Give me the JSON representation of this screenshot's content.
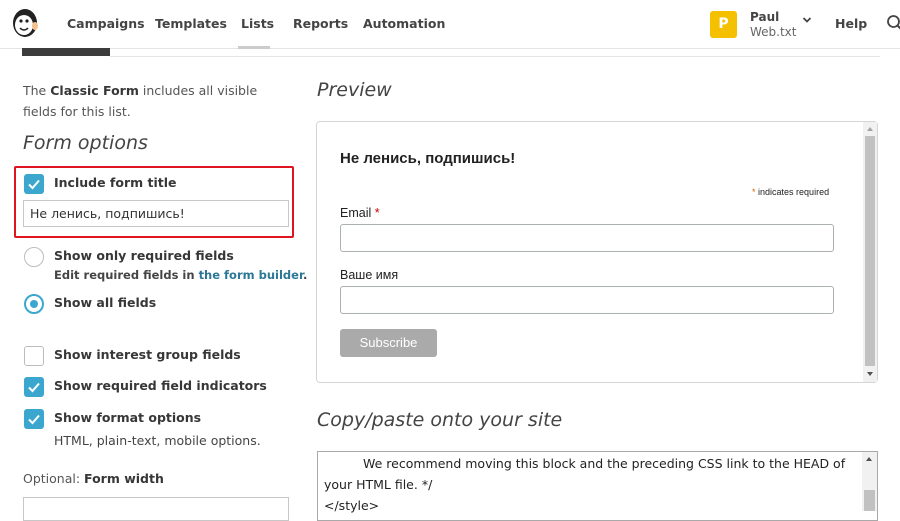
{
  "nav": {
    "items": [
      "Campaigns",
      "Templates",
      "Lists",
      "Reports",
      "Automation"
    ],
    "active": "Lists",
    "user": {
      "initial": "P",
      "name": "Paul",
      "org": "Web.txt"
    },
    "help": "Help"
  },
  "intro": {
    "prefix": "The ",
    "bold": "Classic Form",
    "suffix": " includes all visible fields for this list."
  },
  "form_options": {
    "heading": "Form options",
    "include_title": {
      "label": "Include form title",
      "checked": true,
      "value": "Не ленись, подпишись!"
    },
    "required_only": {
      "label": "Show only required fields",
      "checked": false,
      "sub_prefix": "Edit required fields in ",
      "sub_link": "the form builder",
      "sub_suffix": "."
    },
    "all_fields": {
      "label": "Show all fields",
      "checked": true
    },
    "interest_groups": {
      "label": "Show interest group fields",
      "checked": false
    },
    "required_indicators": {
      "label": "Show required field indicators",
      "checked": true
    },
    "format_options": {
      "label": "Show format options",
      "checked": true,
      "sub": "HTML, plain-text, mobile options."
    },
    "width": {
      "prefix": "Optional: ",
      "label": "Form width",
      "value": ""
    }
  },
  "preview": {
    "heading": "Preview",
    "form_title": "Не ленись, подпишись!",
    "required_note": "indicates required",
    "star": "*",
    "email_label": "Email",
    "name_label": "Ваше имя",
    "subscribe": "Subscribe"
  },
  "copy": {
    "heading": "Copy/paste onto your site",
    "code": "We recommend moving this block and the preceding CSS link to the HEAD of your HTML file. */\n</style>"
  },
  "colors": {
    "accent": "#3ba7cf",
    "highlight_box": "#e0141e",
    "link": "#2c7797",
    "avatar": "#f5c000"
  }
}
